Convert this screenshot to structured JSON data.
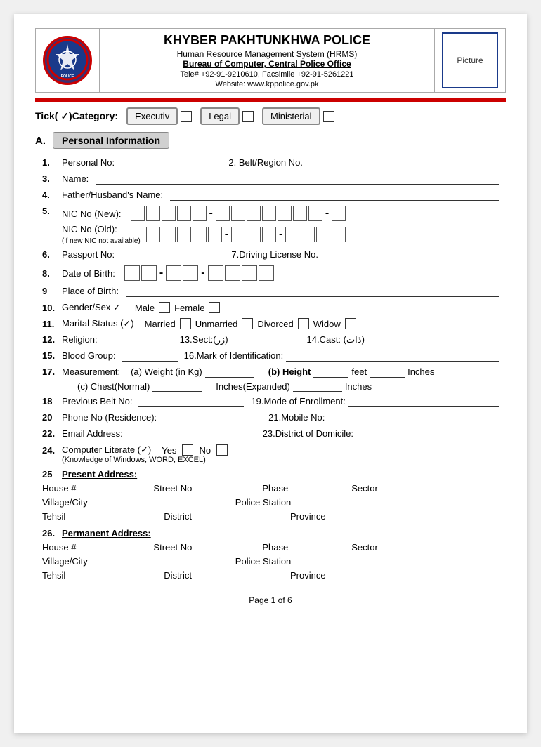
{
  "header": {
    "org_name": "KHYBER PAKHTUNKHWA POLICE",
    "system": "Human Resource Management System (HRMS)",
    "bureau": "Bureau of Computer, Central Police Office",
    "contact": "Tele# +92-91-9210610, Facsimile +92-91-5261221",
    "website": "Website: www.kppolice.gov.pk",
    "picture_label": "Picture"
  },
  "category": {
    "label": "Tick( ✓)Category:",
    "options": [
      "Executiv",
      "Legal",
      "Ministerial"
    ]
  },
  "section_a": {
    "letter": "A.",
    "title": "Personal Information"
  },
  "fields": {
    "f1_label": "1.",
    "f1_text": "Personal No:",
    "f2_label": "2.",
    "f2_text": "Belt/Region No.",
    "f3_label": "3.",
    "f3_text": "Name:",
    "f4_label": "4.",
    "f4_text": "Father/Husband's Name:",
    "f5a_label": "5.",
    "f5a_text": "NIC No (New):",
    "f5b_text": "NIC No (Old):",
    "f5b_sub": "(if new NIC not available)",
    "f6_label": "6.",
    "f6_text": "Passport No:",
    "f7_label": "7.",
    "f7_text": "Driving License No.",
    "f8_label": "8.",
    "f8_text": "Date of Birth:",
    "f9_label": "9",
    "f9_text": "Place of Birth:",
    "f10_label": "10.",
    "f10_text": "Gender/Sex ✓",
    "f10_male": "Male",
    "f10_female": "Female",
    "f11_label": "11.",
    "f11_text": "Marital Status (✓)",
    "f11_married": "Married",
    "f11_unmarried": "Unmarried",
    "f11_divorced": "Divorced",
    "f11_widow": "Widow",
    "f12_label": "12.",
    "f12_text": "Religion:",
    "f13_label": "13.",
    "f13_text": "Sect:(زر)",
    "f14_label": "14.",
    "f14_text": "Cast: (ذات)",
    "f15_label": "15.",
    "f15_text": "Blood Group:",
    "f16_label": "16.",
    "f16_text": "Mark of Identification:",
    "f17_label": "17.",
    "f17_text": "Measurement:",
    "f17a": "(a) Weight (in Kg)",
    "f17b": "(b) Height",
    "f17b_feet": "feet",
    "f17b_inches": "Inches",
    "f17c": "(c) Chest(Normal)",
    "f17c_expanded": "Inches(Expanded)",
    "f17c_inches": "Inches",
    "f18_label": "18",
    "f18_text": "Previous Belt No:",
    "f19_label": "19.",
    "f19_text": "Mode of Enrollment:",
    "f20_label": "20",
    "f20_text": "Phone No (Residence):",
    "f21_label": "21.",
    "f21_text": "Mobile No:",
    "f22_label": "22.",
    "f22_text": "Email Address:",
    "f23_label": "23.",
    "f23_text": "District of Domicile:",
    "f24_label": "24.",
    "f24_text": "Computer Literate (✓)",
    "f24_yes": "Yes",
    "f24_no": "No",
    "f24_sub": "(Knowledge of Windows, WORD, EXCEL)",
    "f25_label": "25",
    "f25_text": "Present Address:",
    "f26_label": "26.",
    "f26_text": "Permanent Address:"
  },
  "present_address": {
    "house": "House #",
    "street": "Street No",
    "phase": "Phase",
    "sector": "Sector",
    "village": "Village/City",
    "police_station": "Police Station",
    "tehsil": "Tehsil",
    "district": "District",
    "province": "Province"
  },
  "permanent_address": {
    "house": "House #",
    "street": "Street No",
    "phase": "Phase",
    "sector": "Sector",
    "village": "Village/City",
    "police_station": "Police Station",
    "tehsil": "Tehsil",
    "district": "District",
    "province": "Province"
  },
  "footer": {
    "text": "Page 1 of 6"
  }
}
